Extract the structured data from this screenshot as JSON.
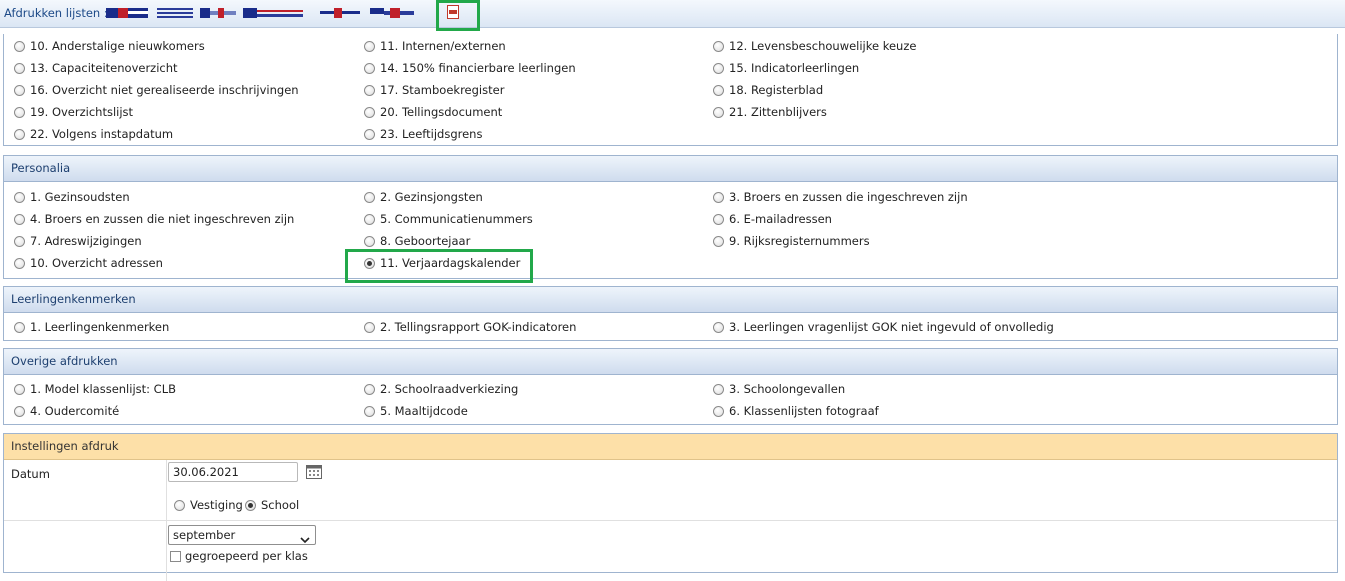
{
  "toolbar": {
    "label": "Afdrukken lijsten :",
    "icons": [
      "flag-icon",
      "flag-icon",
      "flag-icon",
      "flag-icon",
      "flag-icon",
      "flag-icon",
      "pdf-icon"
    ]
  },
  "top_list": {
    "items": [
      {
        "label": "10. Anderstalige nieuwkomers"
      },
      {
        "label": "11. Internen/externen"
      },
      {
        "label": "12. Levensbeschouwelijke keuze"
      },
      {
        "label": "13. Capaciteitenoverzicht"
      },
      {
        "label": "14. 150% financierbare leerlingen"
      },
      {
        "label": "15. Indicatorleerlingen"
      },
      {
        "label": "16. Overzicht niet gerealiseerde inschrijvingen"
      },
      {
        "label": "17. Stamboekregister"
      },
      {
        "label": "18. Registerblad"
      },
      {
        "label": "19. Overzichtslijst"
      },
      {
        "label": "20. Tellingsdocument"
      },
      {
        "label": "21. Zittenblijvers"
      },
      {
        "label": "22. Volgens instapdatum"
      },
      {
        "label": "23. Leeftijdsgrens"
      }
    ]
  },
  "personalia": {
    "title": "Personalia",
    "items": [
      {
        "label": "1. Gezinsoudsten"
      },
      {
        "label": "2. Gezinsjongsten"
      },
      {
        "label": "3. Broers en zussen die ingeschreven zijn"
      },
      {
        "label": "4. Broers en zussen die niet ingeschreven zijn"
      },
      {
        "label": "5. Communicatienummers"
      },
      {
        "label": "6. E-mailadressen"
      },
      {
        "label": "7. Adreswijzigingen"
      },
      {
        "label": "8. Geboortejaar"
      },
      {
        "label": "9. Rijksregisternummers"
      },
      {
        "label": "10. Overzicht adressen"
      },
      {
        "label": "11. Verjaardagskalender",
        "selected": true
      }
    ]
  },
  "leerlingenkenmerken": {
    "title": "Leerlingenkenmerken",
    "items": [
      {
        "label": "1. Leerlingenkenmerken"
      },
      {
        "label": "2. Tellingsrapport GOK-indicatoren"
      },
      {
        "label": "3. Leerlingen vragenlijst GOK niet ingevuld of onvolledig"
      }
    ]
  },
  "overige": {
    "title": "Overige afdrukken",
    "items": [
      {
        "label": "1. Model klassenlijst: CLB"
      },
      {
        "label": "2. Schoolraadverkiezing"
      },
      {
        "label": "3. Schoolongevallen"
      },
      {
        "label": "4. Oudercomité"
      },
      {
        "label": "5. Maaltijdcode"
      },
      {
        "label": "6. Klassenlijsten fotograaf"
      }
    ]
  },
  "settings": {
    "title": "Instellingen afdruk",
    "date_label": "Datum",
    "date_value": "30.06.2021",
    "scope_options": [
      {
        "label": "Vestiging",
        "selected": false
      },
      {
        "label": "School",
        "selected": true
      }
    ],
    "month_value": "september",
    "grouped_label": "gegroepeerd per klas",
    "grouped_checked": false
  }
}
